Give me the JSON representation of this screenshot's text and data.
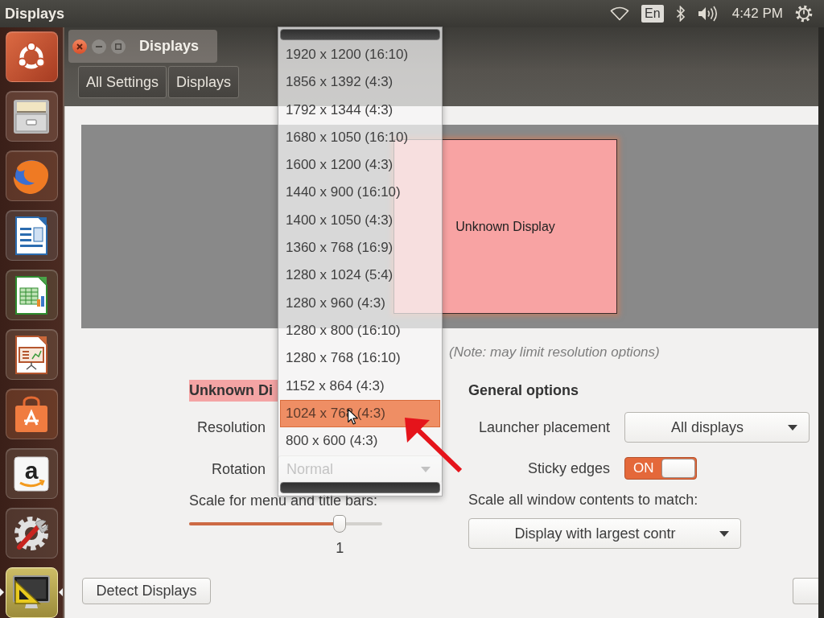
{
  "top_panel": {
    "app_title": "Displays",
    "keyboard_layout": "En",
    "clock": "4:42 PM"
  },
  "launcher": [
    {
      "kind": "dash",
      "selected": false
    },
    {
      "kind": "files",
      "selected": false
    },
    {
      "kind": "browser",
      "selected": false
    },
    {
      "kind": "writer",
      "selected": false
    },
    {
      "kind": "calc",
      "selected": false
    },
    {
      "kind": "impress",
      "selected": false
    },
    {
      "kind": "store",
      "selected": false
    },
    {
      "kind": "amazon",
      "glyph": "a",
      "selected": false
    },
    {
      "kind": "settings",
      "selected": false
    },
    {
      "kind": "displays",
      "selected": true
    }
  ],
  "window": {
    "title": "Displays",
    "breadcrumb": [
      {
        "label": "All Settings"
      },
      {
        "label": "Displays"
      }
    ]
  },
  "arrangement": {
    "display_label": "Unknown Display"
  },
  "mirror_note": "(Note: may limit resolution options)",
  "display_settings": {
    "heading": "Unknown Di",
    "resolution_label": "Resolution",
    "rotation_label": "Rotation",
    "rotation_value": "Normal",
    "scale_label": "Scale for menu and title bars:",
    "scale_slider": {
      "level": 0.78
    },
    "scale_value": "1"
  },
  "general_options": {
    "heading": "General options",
    "launcher_placement_label": "Launcher placement",
    "launcher_placement_value": "All displays",
    "sticky_edges_label": "Sticky edges",
    "sticky_edges": {
      "on": true,
      "label": "ON"
    },
    "scale_all_label": "Scale all window contents to match:",
    "scale_all_value": "Display with largest contr"
  },
  "bottom_buttons": [
    {
      "label": "Detect Displays"
    }
  ],
  "resolution_menu": [
    {
      "label": "1920 x 1200 (16:10)",
      "selected": false
    },
    {
      "label": "1856 x 1392 (4:3)",
      "selected": false
    },
    {
      "label": "1792 x 1344 (4:3)",
      "selected": false
    },
    {
      "label": "1680 x 1050 (16:10)",
      "selected": false
    },
    {
      "label": "1600 x 1200 (4:3)",
      "selected": false
    },
    {
      "label": "1440 x 900 (16:10)",
      "selected": false
    },
    {
      "label": "1400 x 1050 (4:3)",
      "selected": false
    },
    {
      "label": "1360 x 768 (16:9)",
      "selected": false
    },
    {
      "label": "1280 x 1024 (5:4)",
      "selected": false
    },
    {
      "label": "1280 x 960 (4:3)",
      "selected": false
    },
    {
      "label": "1280 x 800 (16:10)",
      "selected": false
    },
    {
      "label": "1280 x 768 (16:10)",
      "selected": false
    },
    {
      "label": "1152 x 864 (4:3)",
      "selected": false
    },
    {
      "label": "1024 x 768 (4:3)",
      "selected": true
    },
    {
      "label": "800 x 600 (4:3)",
      "selected": false
    }
  ]
}
